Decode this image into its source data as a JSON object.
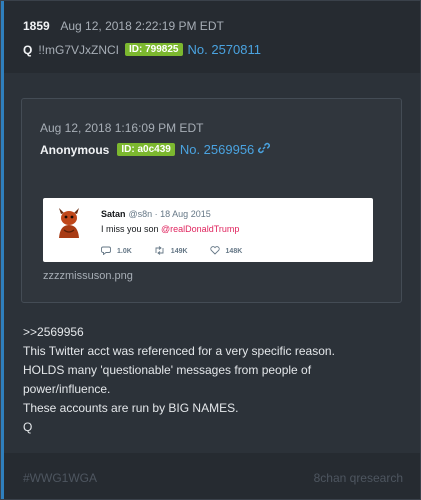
{
  "post": {
    "number": "1859",
    "date": "Aug 12, 2018 2:22:19 PM EDT",
    "author": "Q",
    "tripcode": "!!mG7VJxZNCI",
    "id_badge": "ID: 799825",
    "post_no": "No. 2570811"
  },
  "quoted": {
    "date": "Aug 12, 2018 1:16:09 PM EDT",
    "author": "Anonymous",
    "id_badge": "ID: a0c439",
    "post_no": "No. 2569956",
    "link_icon": "link-icon",
    "filename": "zzzzmissuson.png",
    "tweet": {
      "name": "Satan",
      "handle": "@s8n · 18 Aug 2015",
      "text": "I miss you son ",
      "mention": "@realDonaldTrump",
      "replies": "1.0K",
      "retweets": "149K",
      "likes": "148K"
    }
  },
  "body_lines": [
    ">>2569956",
    "This Twitter acct was referenced for a very specific reason.",
    "HOLDS many 'questionable' messages from people of",
    "power/influence.",
    "These accounts are run by BIG NAMES.",
    "Q"
  ],
  "footer": {
    "tag": "#WWG1WGA",
    "site": "8chan qresearch"
  },
  "colors": {
    "background": "#2c3239",
    "accent": "#2f7fbd",
    "id_badge": "#7cb82f",
    "link": "#4aa3e0"
  }
}
